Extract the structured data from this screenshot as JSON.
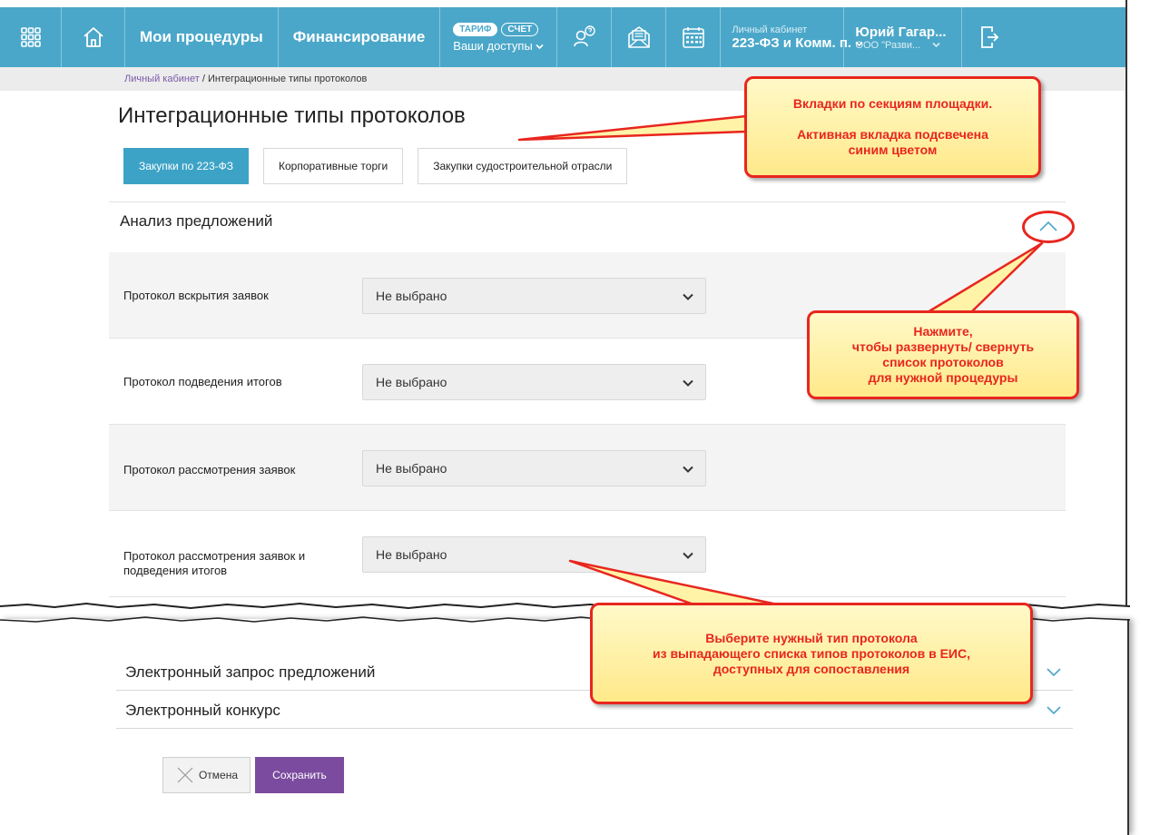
{
  "topnav": {
    "my_procedures": "Мои процедуры",
    "financing": "Финансирование",
    "badge_tariff": "ТАРИФ",
    "badge_invoice": "СЧЕТ",
    "access_label": "Ваши доступы",
    "cabinet_small": "Личный кабинет",
    "cabinet_value": "223-ФЗ и Комм. п.",
    "user_name": "Юрий Гагар...",
    "user_org": "ООО \"Разви..."
  },
  "breadcrumb": {
    "link": "Личный кабинет",
    "separator": " / ",
    "current": "Интеграционные типы протоколов"
  },
  "page": {
    "title": "Интеграционные типы протоколов"
  },
  "tabs": [
    {
      "label": "Закупки по 223-ФЗ",
      "active": true
    },
    {
      "label": "Корпоративные торги",
      "active": false
    },
    {
      "label": "Закупки судостроительной отрасли",
      "active": false
    }
  ],
  "section_open": {
    "title": "Анализ предложений",
    "rows": [
      {
        "label": "Протокол вскрытия заявок",
        "value": "Не выбрано"
      },
      {
        "label": "Протокол подведения итогов",
        "value": "Не выбрано"
      },
      {
        "label": "Протокол рассмотрения заявок",
        "value": "Не выбрано"
      },
      {
        "label": "Протокол рассмотрения заявок и подведения итогов",
        "value": "Не выбрано"
      }
    ]
  },
  "sections_collapsed": [
    {
      "title": "Электронный запрос предложений"
    },
    {
      "title": "Электронный конкурс"
    }
  ],
  "buttons": {
    "cancel": "Отмена",
    "save": "Сохранить"
  },
  "callouts": {
    "tabs_line1": "Вкладки по секциям площадки.",
    "tabs_line2": "Активная вкладка подсвечена",
    "tabs_line3": "синим цветом",
    "toggle_line1": "Нажмите,",
    "toggle_line2": "чтобы развернуть/ свернуть",
    "toggle_line3": "список протоколов",
    "toggle_line4": "для нужной процедуры",
    "select_line1": "Выберите нужный тип протокола",
    "select_line2": "из выпадающего списка типов протоколов в ЕИС,",
    "select_line3": "доступных для сопоставления"
  },
  "colors": {
    "nav": "#4aa7c9",
    "tab_active": "#3da3c6",
    "save_button": "#7b4b9f",
    "callout_border": "#e8261e"
  },
  "icons": [
    "apps-grid-icon",
    "home-icon",
    "support-icon",
    "mail-icon",
    "calendar-icon",
    "logout-icon",
    "chevron-down-icon",
    "chevron-up-icon",
    "close-icon"
  ]
}
